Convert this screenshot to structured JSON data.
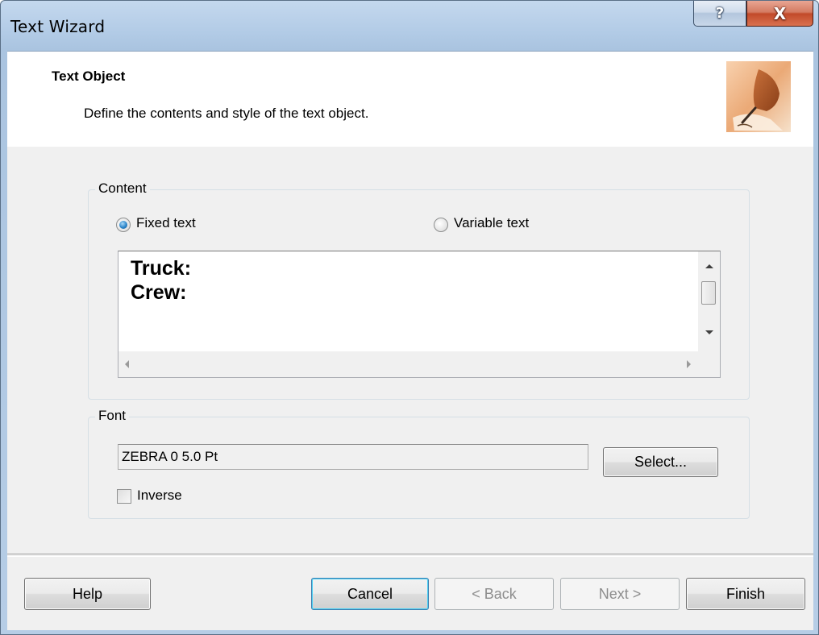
{
  "window": {
    "title": "Text Wizard",
    "help_glyph": "?",
    "close_glyph": "X"
  },
  "header": {
    "title": "Text Object",
    "subtitle": "Define the contents and style of the text object.",
    "image_icon": "pen-writing-icon"
  },
  "content_group": {
    "legend": "Content",
    "fixed_text_label": "Fixed text",
    "variable_text_label": "Variable text",
    "selected": "fixed",
    "text_lines": [
      "Truck:",
      "Crew:"
    ]
  },
  "font_group": {
    "legend": "Font",
    "font_value": "ZEBRA 0 5.0 Pt",
    "select_button": "Select...",
    "inverse_label": "Inverse",
    "inverse_checked": false
  },
  "footer": {
    "help": "Help",
    "cancel": "Cancel",
    "back": "< Back",
    "next": "Next >",
    "finish": "Finish"
  }
}
